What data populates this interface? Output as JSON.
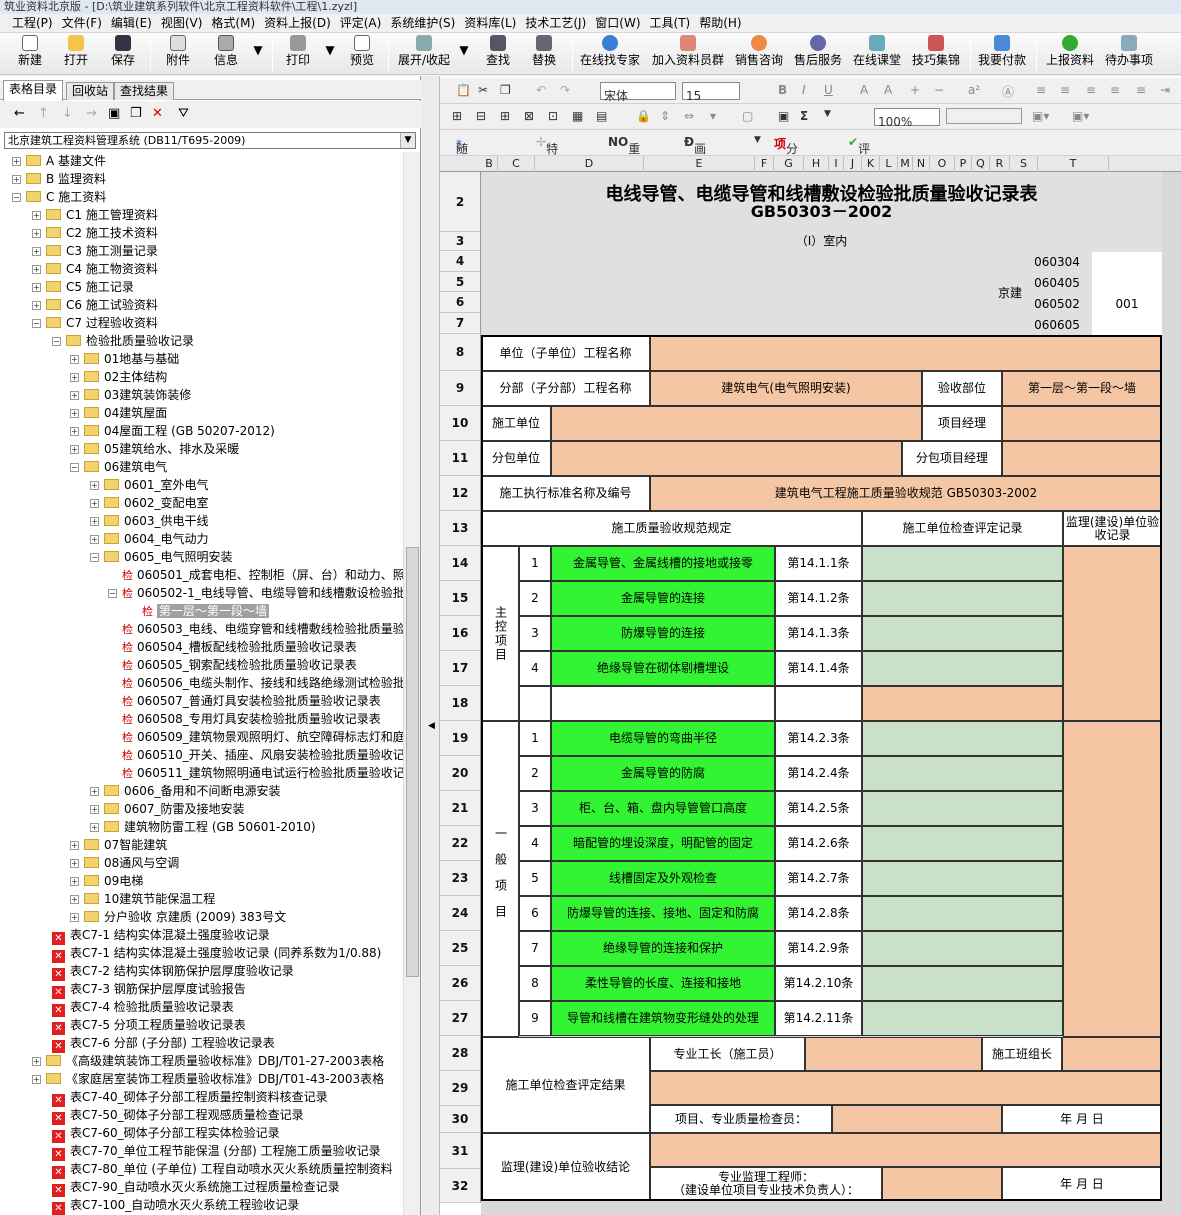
{
  "window": {
    "title": "筑业资料北京版 - [D:\\筑业建筑系列软件\\北京工程资料软件\\工程\\1.zyzl]"
  },
  "menu": [
    "工程(P)",
    "文件(F)",
    "编辑(E)",
    "视图(V)",
    "格式(M)",
    "资料上报(D)",
    "评定(A)",
    "系统维护(S)",
    "资料库(L)",
    "技术工艺(J)",
    "窗口(W)",
    "工具(T)",
    "帮助(H)"
  ],
  "toolbar": {
    "new": "新建",
    "open": "打开",
    "save": "保存",
    "attach": "附件",
    "info": "信息",
    "print": "打印",
    "preview": "预览",
    "expand": "展开/收起",
    "find": "查找",
    "replace": "替换",
    "expert": "在线找专家",
    "join": "加入资料员群",
    "sales": "销售咨询",
    "service": "售后服务",
    "classroom": "在线课堂",
    "tips": "技巧集锦",
    "pay": "我要付款",
    "upload": "上报资料",
    "todo": "待办事项"
  },
  "left": {
    "tabs": [
      "表格目录",
      "回收站",
      "查找结果"
    ],
    "system": "北京建筑工程资料管理系统 (DB11/T695-2009)"
  },
  "tree": [
    {
      "t": "A 基建文件",
      "l": 0,
      "k": "f",
      "x": "+"
    },
    {
      "t": "B 监理资料",
      "l": 0,
      "k": "f",
      "x": "+"
    },
    {
      "t": "C 施工资料",
      "l": 0,
      "k": "f",
      "x": "-"
    },
    {
      "t": "C1 施工管理资料",
      "l": 1,
      "k": "f",
      "x": "+"
    },
    {
      "t": "C2 施工技术资料",
      "l": 1,
      "k": "f",
      "x": "+"
    },
    {
      "t": "C3 施工测量记录",
      "l": 1,
      "k": "f",
      "x": "+"
    },
    {
      "t": "C4 施工物资资料",
      "l": 1,
      "k": "f",
      "x": "+"
    },
    {
      "t": "C5 施工记录",
      "l": 1,
      "k": "f",
      "x": "+"
    },
    {
      "t": "C6 施工试验资料",
      "l": 1,
      "k": "f",
      "x": "+"
    },
    {
      "t": "C7 过程验收资料",
      "l": 1,
      "k": "f",
      "x": "-"
    },
    {
      "t": "检验批质量验收记录",
      "l": 2,
      "k": "f",
      "x": "-"
    },
    {
      "t": "01地基与基础",
      "l": 3,
      "k": "f",
      "x": "+"
    },
    {
      "t": "02主体结构",
      "l": 3,
      "k": "f",
      "x": "+"
    },
    {
      "t": "03建筑装饰装修",
      "l": 3,
      "k": "f",
      "x": "+"
    },
    {
      "t": "04建筑屋面",
      "l": 3,
      "k": "f",
      "x": "+"
    },
    {
      "t": "04屋面工程 (GB 50207-2012)",
      "l": 3,
      "k": "f",
      "x": "+"
    },
    {
      "t": "05建筑给水、排水及采暖",
      "l": 3,
      "k": "f",
      "x": "+"
    },
    {
      "t": "06建筑电气",
      "l": 3,
      "k": "f",
      "x": "-"
    },
    {
      "t": "0601_室外电气",
      "l": 4,
      "k": "f",
      "x": "+"
    },
    {
      "t": "0602_变配电室",
      "l": 4,
      "k": "f",
      "x": "+"
    },
    {
      "t": "0603_供电干线",
      "l": 4,
      "k": "f",
      "x": "+"
    },
    {
      "t": "0604_电气动力",
      "l": 4,
      "k": "f",
      "x": "+"
    },
    {
      "t": "0605_电气照明安装",
      "l": 4,
      "k": "f",
      "x": "-"
    },
    {
      "t": "060501_成套电柜、控制柜（屏、台）和动力、照",
      "l": 5,
      "k": "c",
      "x": ""
    },
    {
      "t": "060502-1_电线导管、电缆导管和线槽敷设检验批",
      "l": 5,
      "k": "c",
      "x": "-"
    },
    {
      "t": "第一层～第一段～墙",
      "l": 6,
      "k": "c",
      "x": "",
      "sel": true
    },
    {
      "t": "060503_电线、电缆穿管和线槽敷线检验批质量验",
      "l": 5,
      "k": "c",
      "x": ""
    },
    {
      "t": "060504_槽板配线检验批质量验收记录表",
      "l": 5,
      "k": "c",
      "x": ""
    },
    {
      "t": "060505_钢索配线检验批质量验收记录表",
      "l": 5,
      "k": "c",
      "x": ""
    },
    {
      "t": "060506_电缆头制作、接线和线路绝缘测试检验批",
      "l": 5,
      "k": "c",
      "x": ""
    },
    {
      "t": "060507_普通灯具安装检验批质量验收记录表",
      "l": 5,
      "k": "c",
      "x": ""
    },
    {
      "t": "060508_专用灯具安装检验批质量验收记录表",
      "l": 5,
      "k": "c",
      "x": ""
    },
    {
      "t": "060509_建筑物景观照明灯、航空障碍标志灯和庭",
      "l": 5,
      "k": "c",
      "x": ""
    },
    {
      "t": "060510_开关、插座、风扇安装检验批质量验收记",
      "l": 5,
      "k": "c",
      "x": ""
    },
    {
      "t": "060511_建筑物照明通电试运行检验批质量验收记",
      "l": 5,
      "k": "c",
      "x": ""
    },
    {
      "t": "0606_备用和不间断电源安装",
      "l": 4,
      "k": "f",
      "x": "+"
    },
    {
      "t": "0607_防雷及接地安装",
      "l": 4,
      "k": "f",
      "x": "+"
    },
    {
      "t": "建筑物防雷工程 (GB 50601-2010)",
      "l": 4,
      "k": "f",
      "x": "+"
    },
    {
      "t": "07智能建筑",
      "l": 3,
      "k": "f",
      "x": "+"
    },
    {
      "t": "08通风与空调",
      "l": 3,
      "k": "f",
      "x": "+"
    },
    {
      "t": "09电梯",
      "l": 3,
      "k": "f",
      "x": "+"
    },
    {
      "t": "10建筑节能保温工程",
      "l": 3,
      "k": "f",
      "x": "+"
    },
    {
      "t": "分户验收 京建质 (2009) 383号文",
      "l": 3,
      "k": "f",
      "x": "+"
    },
    {
      "t": "表C7-1 结构实体混凝土强度验收记录",
      "l": 2,
      "k": "x",
      "x": ""
    },
    {
      "t": "表C7-1 结构实体混凝土强度验收记录 (同养系数为1/0.88)",
      "l": 2,
      "k": "x",
      "x": ""
    },
    {
      "t": "表C7-2 结构实体钢筋保护层厚度验收记录",
      "l": 2,
      "k": "x",
      "x": ""
    },
    {
      "t": "表C7-3 钢筋保护层厚度试验报告",
      "l": 2,
      "k": "x",
      "x": ""
    },
    {
      "t": "表C7-4 检验批质量验收记录表",
      "l": 2,
      "k": "x",
      "x": ""
    },
    {
      "t": "表C7-5 分项工程质量验收记录表",
      "l": 2,
      "k": "x",
      "x": ""
    },
    {
      "t": "表C7-6 分部 (子分部) 工程验收记录表",
      "l": 2,
      "k": "x",
      "x": ""
    },
    {
      "t": "《高级建筑装饰工程质量验收标准》DBJ/T01-27-2003表格",
      "l": 1,
      "k": "f",
      "x": "+"
    },
    {
      "t": "《家庭居室装饰工程质量验收标准》DBJ/T01-43-2003表格",
      "l": 1,
      "k": "f",
      "x": "+"
    },
    {
      "t": "表C7-40_砌体子分部工程质量控制资料核查记录",
      "l": 2,
      "k": "x",
      "x": ""
    },
    {
      "t": "表C7-50_砌体子分部工程观感质量检查记录",
      "l": 2,
      "k": "x",
      "x": ""
    },
    {
      "t": "表C7-60_砌体子分部工程实体检验记录",
      "l": 2,
      "k": "x",
      "x": ""
    },
    {
      "t": "表C7-70_单位工程节能保温 (分部) 工程施工质量验收记录",
      "l": 2,
      "k": "x",
      "x": ""
    },
    {
      "t": "表C7-80_单位 (子单位) 工程自动喷水灭火系统质量控制资料",
      "l": 2,
      "k": "x",
      "x": ""
    },
    {
      "t": "表C7-90_自动喷水灭火系统施工过程质量检查记录",
      "l": 2,
      "k": "x",
      "x": ""
    },
    {
      "t": "表C7-100_自动喷水灭火系统工程验收记录",
      "l": 2,
      "k": "x",
      "x": ""
    }
  ],
  "rtool": {
    "font": "宋体",
    "size": "15",
    "zoom": "100%",
    "random": "随机数",
    "special": "特殊符号",
    "renumber": "重新编号",
    "strike": "画删除线",
    "split": "分部分项",
    "evaluate": "评定",
    "sum": "Σ"
  },
  "columns": [
    "B",
    "C",
    "D",
    "E",
    "F",
    "G",
    "H",
    "I",
    "J",
    "K",
    "L",
    "M",
    "N",
    "O",
    "P",
    "Q",
    "R",
    "S",
    "T"
  ],
  "rows": [
    "2",
    "3",
    "4",
    "5",
    "6",
    "7",
    "8",
    "9",
    "10",
    "11",
    "12",
    "13",
    "14",
    "15",
    "16",
    "17",
    "18",
    "19",
    "20",
    "21",
    "22",
    "23",
    "24",
    "25",
    "26",
    "27",
    "28",
    "29",
    "30",
    "31",
    "32"
  ],
  "form": {
    "title": "电线导管、电缆导管和线槽敷设检验批质量验收记录表",
    "std": "GB50303－2002",
    "subtitle": "（Ⅰ）室内",
    "codes": [
      "060304",
      "060405",
      "060502",
      "060605"
    ],
    "jing": "京建",
    "serial": "001",
    "unit_label": "单位（子单位）工程名称",
    "subunit_label": "分部（子分部）工程名称",
    "subunit_value": "建筑电气(电气照明安装)",
    "part_label": "验收部位",
    "part_value": "第一层～第一段～墙",
    "contractor_label": "施工单位",
    "pm_label": "项目经理",
    "subcontractor_label": "分包单位",
    "subpm_label": "分包项目经理",
    "exec_label": "施工执行标准名称及编号",
    "exec_value": "建筑电气工程施工质量验收规范  GB50303-2002",
    "col_spec": "施工质量验收规范规定",
    "col_check": "施工单位检查评定记录",
    "col_sup": "监理(建设)单位验收记录",
    "main_group": "主控项目",
    "general_group": "一般项目",
    "main_items": [
      {
        "n": "1",
        "t": "金属导管、金属线槽的接地或接零",
        "c": "第14.1.1条"
      },
      {
        "n": "2",
        "t": "金属导管的连接",
        "c": "第14.1.2条"
      },
      {
        "n": "3",
        "t": "防爆导管的连接",
        "c": "第14.1.3条"
      },
      {
        "n": "4",
        "t": "绝缘导管在砌体剔槽埋设",
        "c": "第14.1.4条"
      }
    ],
    "general_items": [
      {
        "n": "1",
        "t": "电缆导管的弯曲半径",
        "c": "第14.2.3条"
      },
      {
        "n": "2",
        "t": "金属导管的防腐",
        "c": "第14.2.4条"
      },
      {
        "n": "3",
        "t": "柜、台、箱、盘内导管管口高度",
        "c": "第14.2.5条"
      },
      {
        "n": "4",
        "t": "暗配管的埋设深度，明配管的固定",
        "c": "第14.2.6条"
      },
      {
        "n": "5",
        "t": "线槽固定及外观检查",
        "c": "第14.2.7条"
      },
      {
        "n": "6",
        "t": "防爆导管的连接、接地、固定和防腐",
        "c": "第14.2.8条"
      },
      {
        "n": "7",
        "t": "绝缘导管的连接和保护",
        "c": "第14.2.9条"
      },
      {
        "n": "8",
        "t": "柔性导管的长度、连接和接地",
        "c": "第14.2.10条"
      },
      {
        "n": "9",
        "t": "导管和线槽在建筑物变形缝处的处理",
        "c": "第14.2.11条"
      }
    ],
    "foreman_label": "专业工长（施工员）",
    "team_label": "施工班组长",
    "result_label": "施工单位检查评定结果",
    "inspector_label": "项目、专业质量检查员：",
    "date_label": "年  月  日",
    "sup_label": "监理(建设)单位验收结论",
    "engineer_label": "专业监理工程师：\n（建设单位项目专业技术负责人）："
  }
}
